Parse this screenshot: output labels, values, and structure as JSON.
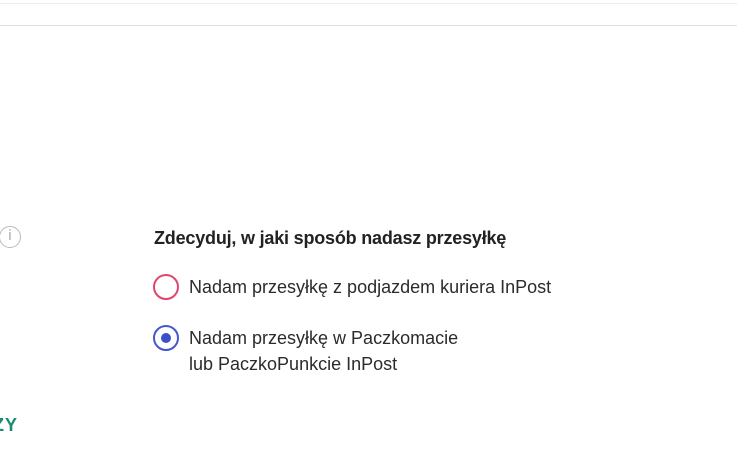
{
  "header": {
    "visible": true
  },
  "info": {
    "icon": "info-icon",
    "glyph": "i"
  },
  "form": {
    "question": "Zdecyduj, w jaki sposób nadasz przesyłkę",
    "options": [
      {
        "label_line1": "Nadam przesyłkę z podjazdem kuriera InPost",
        "label_line2": "",
        "checked": false
      },
      {
        "label_line1": "Nadam przesyłkę w Paczkomacie",
        "label_line2": "lub PaczkoPunkcie InPost",
        "checked": true
      }
    ]
  },
  "link": {
    "partial_text": "ZY"
  },
  "colors": {
    "accent_selected": "#3a4fc8",
    "accent_unselected": "#e0466b",
    "link_green": "#1c8a77"
  }
}
